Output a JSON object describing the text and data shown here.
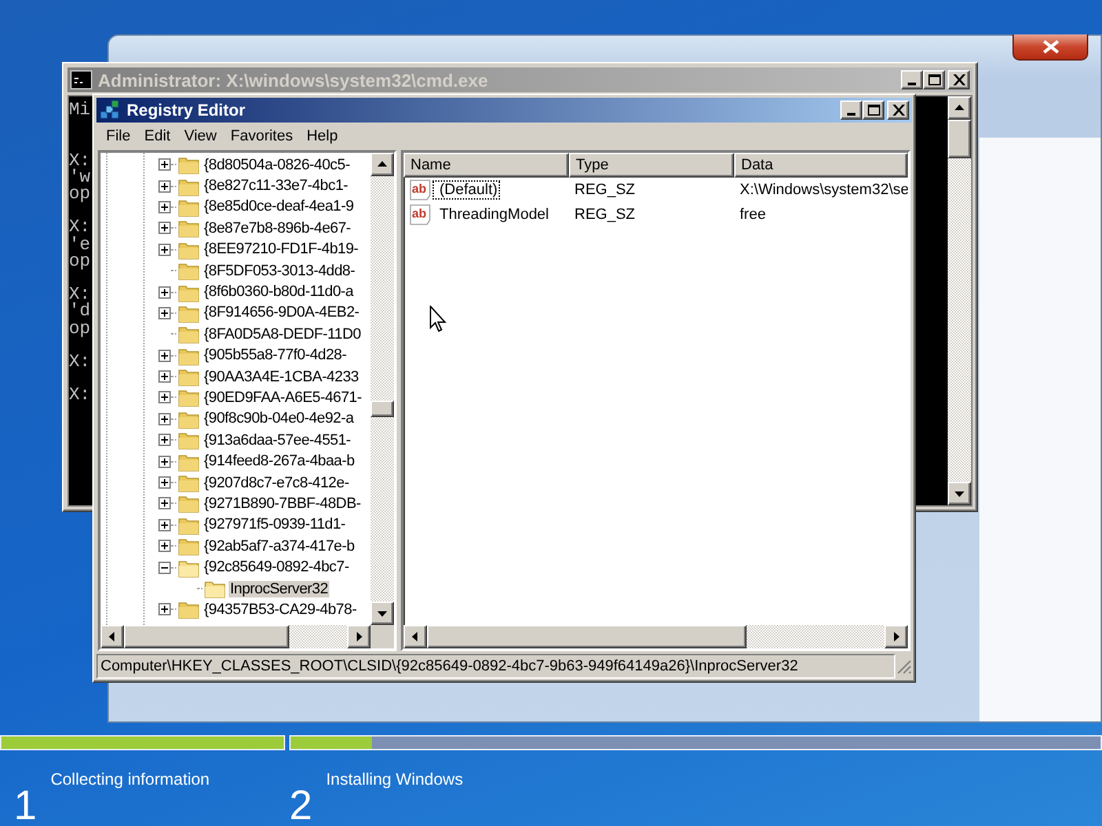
{
  "console_window": {
    "title": "Administrator: X:\\windows\\system32\\cmd.exe",
    "active": false,
    "blocks": [
      [
        "Mi"
      ],
      [
        "X:",
        "'w",
        "op"
      ],
      [
        "X:",
        "'e",
        "op"
      ],
      [
        "X:",
        "'d",
        "op"
      ],
      [
        "X:"
      ],
      [
        "X:"
      ]
    ]
  },
  "registry_editor": {
    "title": "Registry Editor",
    "active": true,
    "menu": [
      "File",
      "Edit",
      "View",
      "Favorites",
      "Help"
    ],
    "tree": [
      {
        "label": "{8d80504a-0826-40c5-",
        "has_children": true,
        "expanded": false,
        "selected": false
      },
      {
        "label": "{8e827c11-33e7-4bc1-",
        "has_children": true,
        "expanded": false,
        "selected": false
      },
      {
        "label": "{8e85d0ce-deaf-4ea1-9",
        "has_children": true,
        "expanded": false,
        "selected": false
      },
      {
        "label": "{8e87e7b8-896b-4e67-",
        "has_children": true,
        "expanded": false,
        "selected": false
      },
      {
        "label": "{8EE97210-FD1F-4b19-",
        "has_children": true,
        "expanded": false,
        "selected": false
      },
      {
        "label": "{8F5DF053-3013-4dd8-",
        "has_children": false,
        "expanded": false,
        "selected": false
      },
      {
        "label": "{8f6b0360-b80d-11d0-a",
        "has_children": true,
        "expanded": false,
        "selected": false
      },
      {
        "label": "{8F914656-9D0A-4EB2-",
        "has_children": true,
        "expanded": false,
        "selected": false
      },
      {
        "label": "{8FA0D5A8-DEDF-11D0",
        "has_children": false,
        "expanded": false,
        "selected": false
      },
      {
        "label": "{905b55a8-77f0-4d28-",
        "has_children": true,
        "expanded": false,
        "selected": false
      },
      {
        "label": "{90AA3A4E-1CBA-4233",
        "has_children": true,
        "expanded": false,
        "selected": false
      },
      {
        "label": "{90ED9FAA-A6E5-4671-",
        "has_children": true,
        "expanded": false,
        "selected": false
      },
      {
        "label": "{90f8c90b-04e0-4e92-a",
        "has_children": true,
        "expanded": false,
        "selected": false
      },
      {
        "label": "{913a6daa-57ee-4551-",
        "has_children": true,
        "expanded": false,
        "selected": false
      },
      {
        "label": "{914feed8-267a-4baa-b",
        "has_children": true,
        "expanded": false,
        "selected": false
      },
      {
        "label": "{9207d8c7-e7c8-412e-",
        "has_children": true,
        "expanded": false,
        "selected": false
      },
      {
        "label": "{9271B890-7BBF-48DB-",
        "has_children": true,
        "expanded": false,
        "selected": false
      },
      {
        "label": "{927971f5-0939-11d1-",
        "has_children": true,
        "expanded": false,
        "selected": false
      },
      {
        "label": "{92ab5af7-a374-417e-b",
        "has_children": true,
        "expanded": false,
        "selected": false
      },
      {
        "label": "{92c85649-0892-4bc7-",
        "has_children": true,
        "expanded": true,
        "selected": false,
        "children": [
          {
            "label": "InprocServer32",
            "has_children": false,
            "expanded": false,
            "selected": true
          }
        ]
      },
      {
        "label": "{94357B53-CA29-4b78-",
        "has_children": true,
        "expanded": false,
        "selected": false
      }
    ],
    "columns": [
      "Name",
      "Type",
      "Data"
    ],
    "values": [
      {
        "icon": "ab",
        "name": "(Default)",
        "type": "REG_SZ",
        "data": "X:\\Windows\\system32\\se",
        "focused": true
      },
      {
        "icon": "ab",
        "name": "ThreadingModel",
        "type": "REG_SZ",
        "data": "free",
        "focused": false
      }
    ],
    "status_bar": "Computer\\HKEY_CLASSES_ROOT\\CLSID\\{92c85649-0892-4bc7-9b63-949f64149a26}\\InprocServer32"
  },
  "setup_progress": [
    {
      "number": "1",
      "label": "Collecting information",
      "level": 1
    },
    {
      "number": "2",
      "label": "Installing Windows",
      "level": 0.1
    }
  ]
}
